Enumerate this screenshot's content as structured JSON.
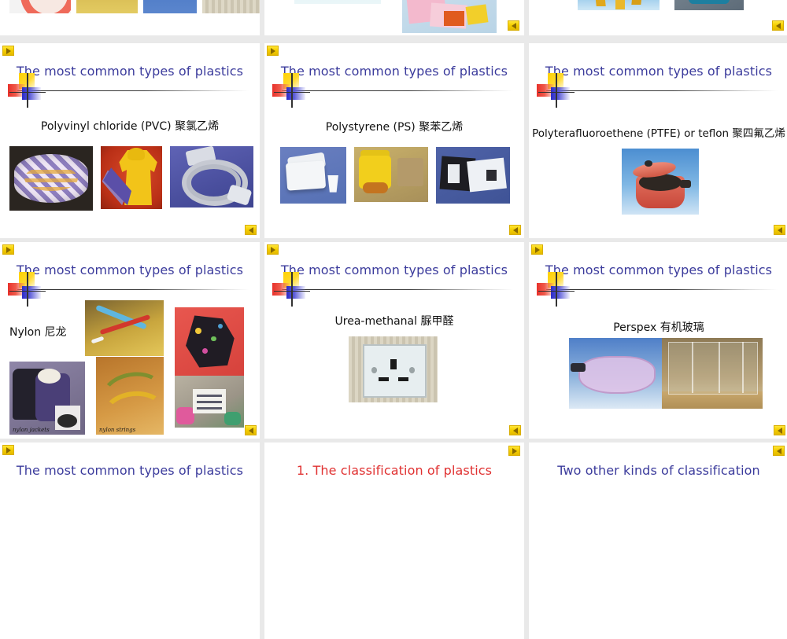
{
  "view": {
    "kind": "slide-grid",
    "columns": 3,
    "background_color": "#e9e9e9",
    "panel_color": "#ffffff"
  },
  "icons": {
    "next": "play-right-icon",
    "prev": "play-left-icon"
  },
  "theme": {
    "title_color": "#3b3b9c",
    "title_red": "#e03131",
    "caption_color": "#111111",
    "chip_yellow": "#f5cf00",
    "logo_yellow": "#ffd100",
    "logo_red": "#e8312b",
    "logo_blue": "#2b2bc8"
  },
  "slides": [
    {
      "id": "row0-col0",
      "title": "",
      "caption": "",
      "photos": [
        "pink-ring-photo",
        "toothbrush-photo",
        "goggles-photo",
        "socket-photo"
      ]
    },
    {
      "id": "row0-col1",
      "title": "",
      "caption": "",
      "photos": [
        "pale-wash-photo",
        "pink-mat-set-photo"
      ]
    },
    {
      "id": "row0-col2",
      "title": "",
      "caption": "",
      "photos": [
        "yellow-stool-photo",
        "blue-bottle-photo"
      ]
    },
    {
      "id": "row1-col0",
      "title": "The most common types of plastics",
      "caption": "Polyvinyl chloride (PVC)  聚氯乙烯",
      "photos": [
        "tablecloth-photo",
        "raincoat-umbrella-photo",
        "electric-cable-photo"
      ]
    },
    {
      "id": "row1-col1",
      "title": "The most common types of plastics",
      "caption": "Polystyrene (PS)  聚苯乙烯",
      "photos": [
        "foam-lunchbox-photo",
        "yellow-takeaway-photo",
        "packing-foam-photo"
      ]
    },
    {
      "id": "row1-col2",
      "title": "The most common types of plastics",
      "caption": "Polyterafluoroethene (PTFE) or teflon  聚四氟乙烯",
      "photos": [
        "teflon-pot-photo"
      ]
    },
    {
      "id": "row2-col0",
      "title": "The most common types of plastics",
      "caption": "Nylon  尼龙",
      "photos": [
        "toothbrushes-photo",
        "patterned-bag-photo",
        "nylon-jackets-photo",
        "nylon-strings-photo",
        "nylon-label-photo"
      ],
      "photo_captions": [
        "nylon jackets",
        "nylon strings"
      ]
    },
    {
      "id": "row2-col1",
      "title": "The most common types of plastics",
      "caption": "Urea-methanal  脲甲醛",
      "photos": [
        "wall-socket-photo"
      ]
    },
    {
      "id": "row2-col2",
      "title": "The most common types of plastics",
      "caption": "Perspex  有机玻璃",
      "photos": [
        "safety-goggles-photo",
        "glass-squash-court-photo"
      ]
    },
    {
      "id": "row3-col0",
      "title": "The most common types of plastics",
      "caption": "",
      "photos": []
    },
    {
      "id": "row3-col1",
      "title": "1. The classification of plastics",
      "title_style": "red",
      "caption": "",
      "photos": []
    },
    {
      "id": "row3-col2",
      "title": "Two other kinds of classification",
      "caption": "",
      "photos": []
    }
  ]
}
